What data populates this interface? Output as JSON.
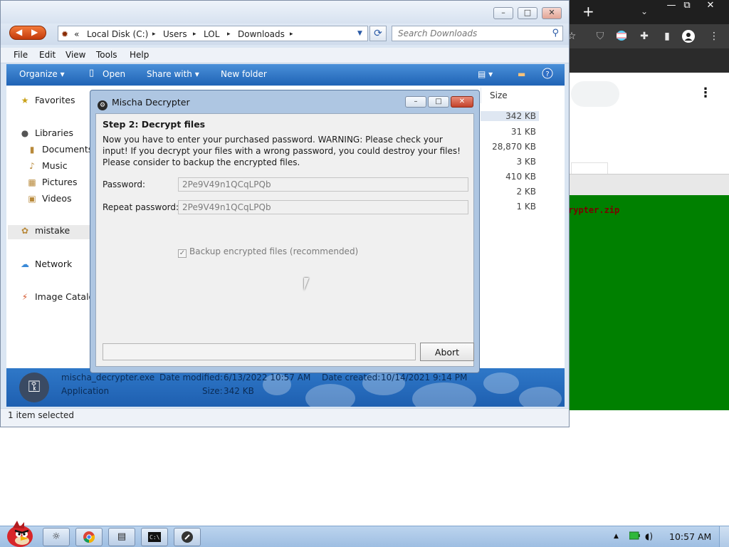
{
  "chrome": {
    "new_tab": "+",
    "tab_dropdown": "⌄",
    "minimize": "—",
    "restore": "⧉",
    "close": "✕",
    "kebab": "⋮",
    "zip_fragment": "rypter.zip",
    "background_color": "#008000"
  },
  "explorer": {
    "minimize": "–",
    "maximize": "□",
    "close": "✕",
    "breadcrumb": {
      "prefix": "«",
      "items": [
        "Local Disk (C:)",
        "Users",
        "LOL",
        "Downloads"
      ],
      "separator": "▸"
    },
    "search": {
      "placeholder": "Search Downloads"
    },
    "menu": [
      "File",
      "Edit",
      "View",
      "Tools",
      "Help"
    ],
    "commands": {
      "organize": "Organize ▾",
      "open": "Open",
      "share_with": "Share with ▾",
      "new_folder": "New folder"
    },
    "nav": {
      "favorites": "Favorites",
      "libraries": "Libraries",
      "documents": "Documents",
      "music": "Music",
      "pictures": "Pictures",
      "videos": "Videos",
      "mistake": "mistake",
      "network": "Network",
      "image_catalog": "Image Catalo"
    },
    "column_header": "Size",
    "sizes": [
      "342 KB",
      "31 KB",
      "28,870 KB",
      "3 KB",
      "410 KB",
      "2 KB",
      "1 KB"
    ],
    "details": {
      "filename": "mischa_decrypter.exe",
      "modified_label": "Date modified:",
      "modified": "6/13/2022 10:57 AM",
      "created_label": "Date created:",
      "created": "10/14/2021 9:14 PM",
      "type": "Application",
      "size_label": "Size:",
      "size": "342 KB"
    },
    "status": "1 item selected"
  },
  "dialog": {
    "title": "Mischa Decrypter",
    "minimize": "–",
    "maximize": "□",
    "close": "✕",
    "step": "Step 2: Decrypt files",
    "warning": "Now you have to enter your purchased password. WARNING: Please check your input! If you decrypt your files with a wrong password, you could destroy your files! Please consider to backup the encrypted files.",
    "password_label": "Password:",
    "password_value": "2Pe9V49n1QCqLPQb",
    "repeat_label": "Repeat password:",
    "repeat_value": "2Pe9V49n1QCqLPQb",
    "backup_label": "Backup encrypted files (recommended)",
    "backup_checked": true,
    "abort_label": "Abort"
  },
  "taskbar": {
    "clock": "10:57 AM",
    "tray_up": "▲",
    "tray_volume": "🔊"
  },
  "colors": {
    "command_bar": "#1f63b5",
    "details_pane": "#1e5fb0",
    "dialog_frame": "#aec6e2",
    "close_button": "#c3422a"
  }
}
